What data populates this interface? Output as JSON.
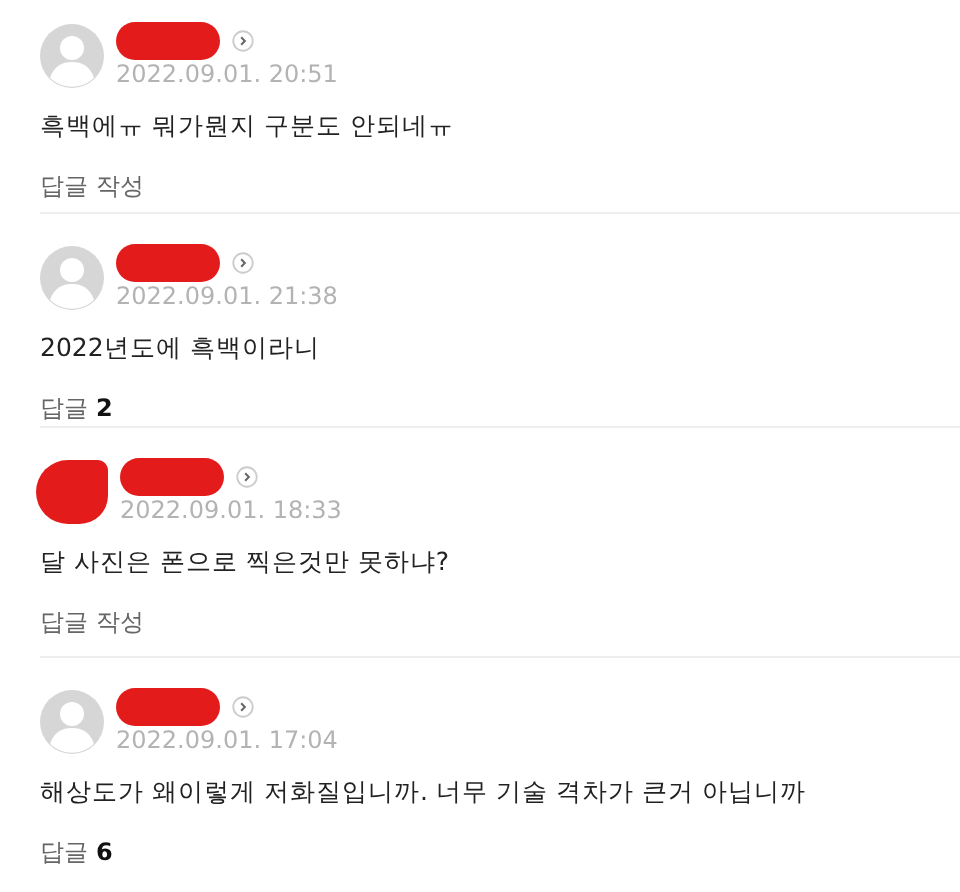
{
  "comments": [
    {
      "date": "2022.09.01. 20:51",
      "text": "흑백에ㅠ 뭐가뭔지 구분도 안되네ㅠ",
      "reply": {
        "label": "답글 작성"
      },
      "avatar_covered": false
    },
    {
      "date": "2022.09.01. 21:38",
      "text": "2022년도에 흑백이라니",
      "reply": {
        "label": "답글",
        "count": "2"
      },
      "avatar_covered": false
    },
    {
      "date": "2022.09.01. 18:33",
      "text": "달 사진은 폰으로 찍은것만 못하냐?",
      "reply": {
        "label": "답글 작성"
      },
      "avatar_covered": true
    },
    {
      "date": "2022.09.01. 17:04",
      "text": "해상도가 왜이렇게 저화질입니까. 너무 기술 격차가 큰거 아닙니까",
      "reply": {
        "label": "답글",
        "count": "6"
      },
      "avatar_covered": false
    }
  ]
}
